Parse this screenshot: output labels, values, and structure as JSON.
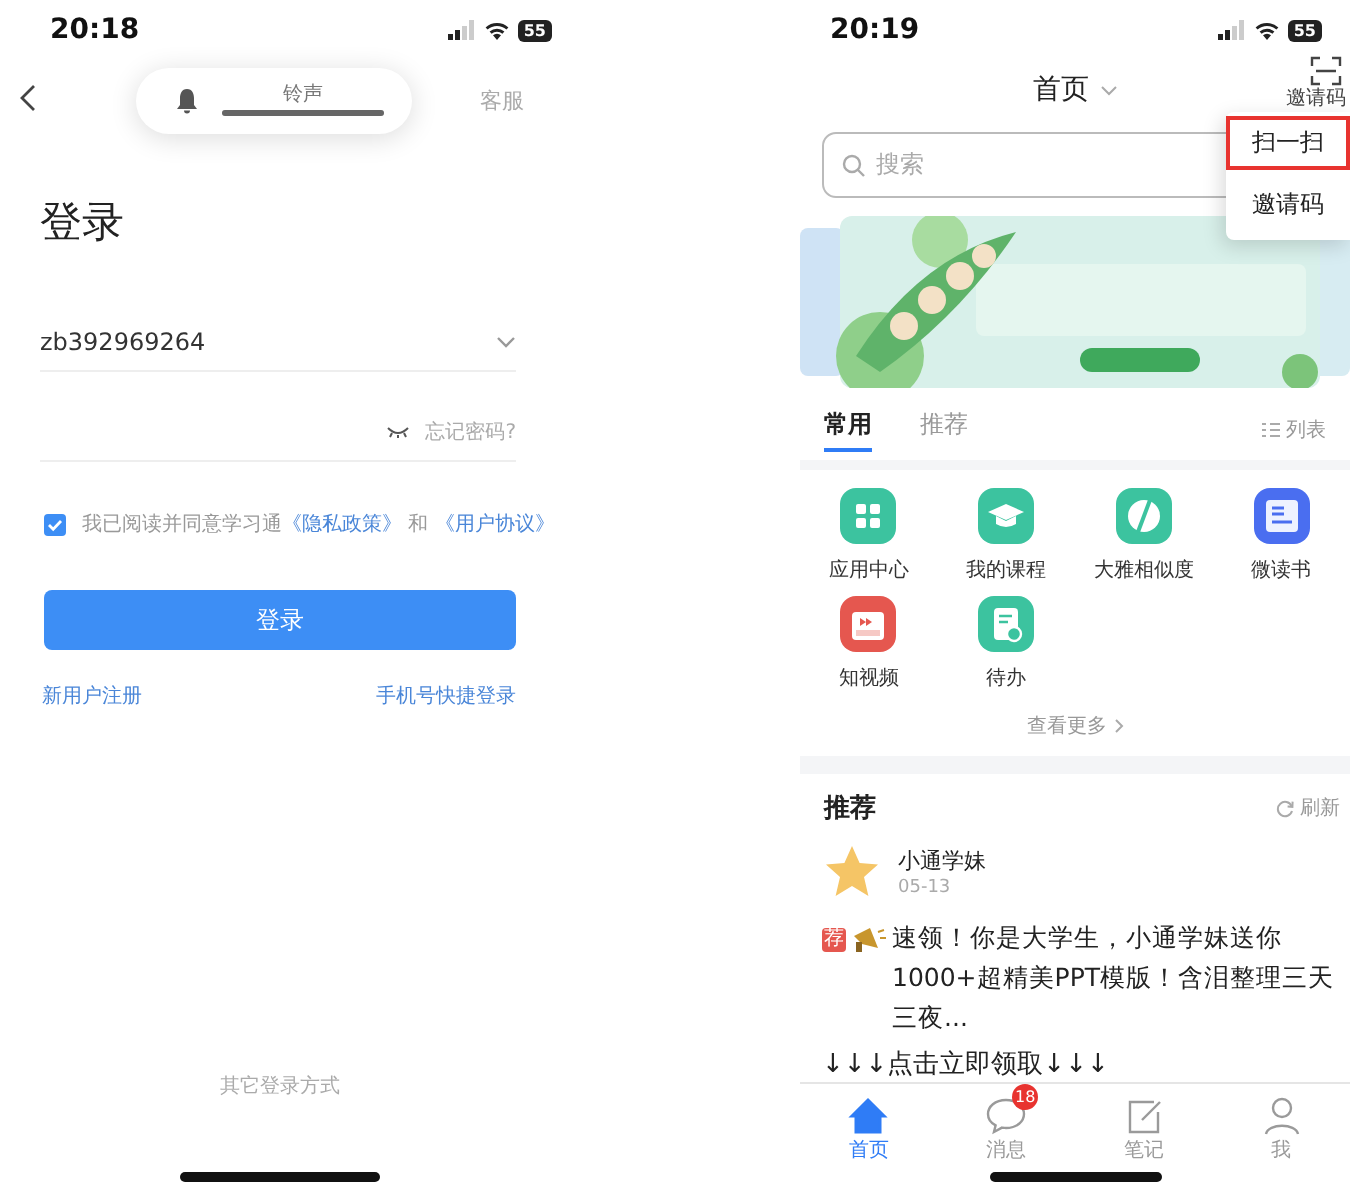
{
  "login_screen": {
    "status_bar": {
      "time": "20:18",
      "battery": "55"
    },
    "volume_hud": {
      "label": "铃声",
      "level": 1
    },
    "header": {
      "service": "客服"
    },
    "title": "登录",
    "account_field": {
      "value": "zb392969264"
    },
    "password_field": {
      "forgot": "忘记密码?"
    },
    "agreement": {
      "checked": true,
      "text": "我已阅读并同意学习通",
      "privacy_link": "《隐私政策》",
      "conjunction": "和",
      "terms_link": "《用户协议》"
    },
    "login_button": "登录",
    "register_link": "新用户注册",
    "phone_login_link": "手机号快捷登录",
    "other_login": "其它登录方式"
  },
  "home_screen": {
    "status_bar": {
      "time": "20:19",
      "battery": "55"
    },
    "header": {
      "title": "首页",
      "scan_label": "邀请码"
    },
    "search": {
      "placeholder": "搜索"
    },
    "popup_menu": [
      {
        "label": "扫一扫",
        "selected": true
      },
      {
        "label": "邀请码",
        "selected": false
      }
    ],
    "tabs": [
      {
        "label": "常用",
        "selected": true
      },
      {
        "label": "推荐",
        "selected": false
      }
    ],
    "list_toggle": "列表",
    "apps": [
      {
        "label": "应用中心",
        "kind": "grid",
        "color": "#3cc39f"
      },
      {
        "label": "我的课程",
        "kind": "cap",
        "color": "#3cc39f"
      },
      {
        "label": "大雅相似度",
        "kind": "pie",
        "color": "#3cc39f"
      },
      {
        "label": "微读书",
        "kind": "book",
        "color": "#4a6ef0"
      },
      {
        "label": "知视频",
        "kind": "video",
        "color": "#e5574f"
      },
      {
        "label": "待办",
        "kind": "todo",
        "color": "#3cc39f"
      }
    ],
    "see_more": "查看更多",
    "recommend": {
      "title": "推荐",
      "refresh": "刷新",
      "post": {
        "author": "小通学妹",
        "date": "05-13",
        "tag": "荐",
        "text": "速领！你是大学生，小通学妹送你1000+超精美PPT模版！含泪整理三天三夜...",
        "link_line": "↓↓↓点击立即领取↓↓↓"
      }
    },
    "tab_bar": [
      {
        "label": "首页",
        "kind": "home",
        "selected": true
      },
      {
        "label": "消息",
        "kind": "chat",
        "selected": false,
        "badge": "18"
      },
      {
        "label": "笔记",
        "kind": "note",
        "selected": false
      },
      {
        "label": "我",
        "kind": "person",
        "selected": false
      }
    ]
  }
}
